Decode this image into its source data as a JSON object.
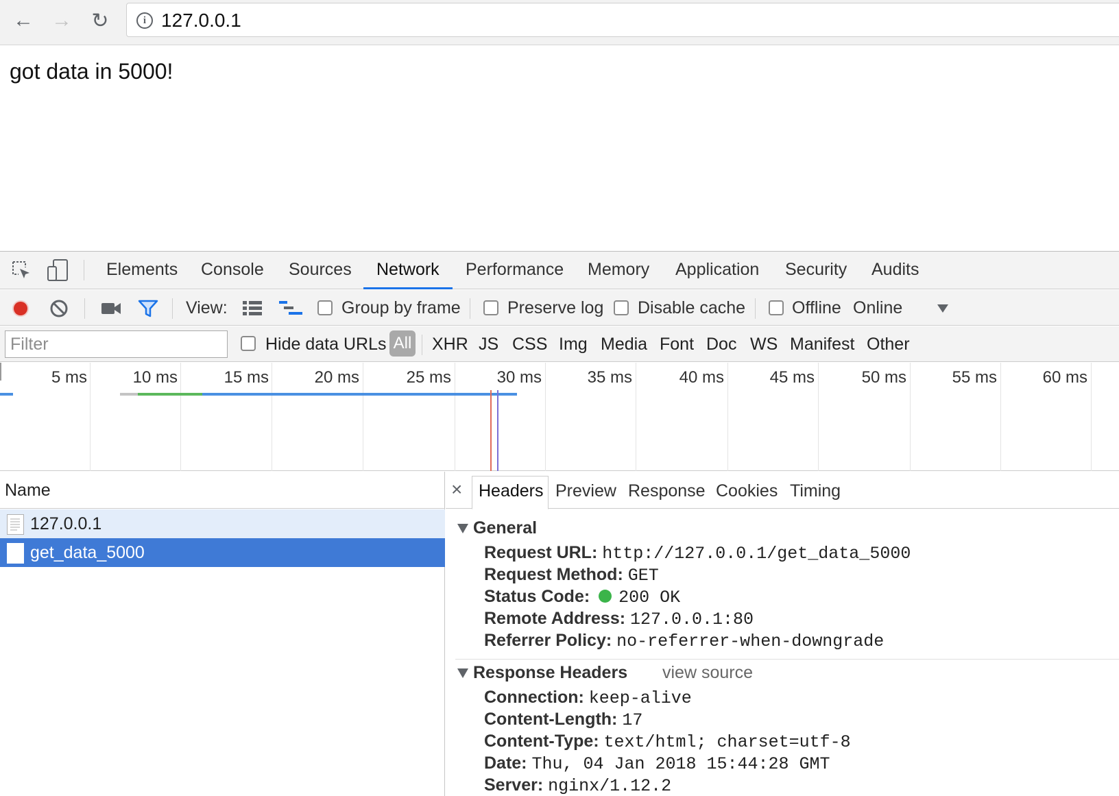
{
  "browser": {
    "back_icon": "←",
    "forward_icon": "→",
    "reload_icon": "↻",
    "info_icon": "i",
    "url": "127.0.0.1"
  },
  "page": {
    "text": "got data in 5000!"
  },
  "devtools": {
    "tabs": [
      "Elements",
      "Console",
      "Sources",
      "Network",
      "Performance",
      "Memory",
      "Application",
      "Security",
      "Audits"
    ],
    "active_tab": "Network",
    "toolbar": {
      "view_label": "View:",
      "group_by_frame": "Group by frame",
      "preserve_log": "Preserve log",
      "disable_cache": "Disable cache",
      "offline": "Offline",
      "online": "Online",
      "record_color": "#d93025",
      "filter_icon_color": "#1a73e8"
    },
    "filterbar": {
      "filter_placeholder": "Filter",
      "hide_data_urls": "Hide data URLs",
      "all": "All",
      "types": [
        "XHR",
        "JS",
        "CSS",
        "Img",
        "Media",
        "Font",
        "Doc",
        "WS",
        "Manifest",
        "Other"
      ]
    },
    "timeline": {
      "ticks": [
        "5 ms",
        "10 ms",
        "15 ms",
        "20 ms",
        "25 ms",
        "30 ms",
        "35 ms",
        "40 ms",
        "45 ms",
        "50 ms",
        "55 ms",
        "60 ms"
      ]
    },
    "requests": {
      "header": "Name",
      "rows": [
        {
          "name": "127.0.0.1",
          "selected": false
        },
        {
          "name": "get_data_5000",
          "selected": true
        }
      ]
    },
    "details": {
      "close_icon": "×",
      "tabs": [
        "Headers",
        "Preview",
        "Response",
        "Cookies",
        "Timing"
      ],
      "active_tab": "Headers",
      "general": {
        "title": "General",
        "items": [
          {
            "key": "Request URL:",
            "value": "http://127.0.0.1/get_data_5000"
          },
          {
            "key": "Request Method:",
            "value": "GET"
          },
          {
            "key": "Status Code:",
            "value": "200 OK"
          },
          {
            "key": "Remote Address:",
            "value": "127.0.0.1:80"
          },
          {
            "key": "Referrer Policy:",
            "value": "no-referrer-when-downgrade"
          }
        ]
      },
      "response_headers": {
        "title": "Response Headers",
        "view_source": "view source",
        "items": [
          {
            "key": "Connection:",
            "value": "keep-alive"
          },
          {
            "key": "Content-Length:",
            "value": "17"
          },
          {
            "key": "Content-Type:",
            "value": "text/html; charset=utf-8"
          },
          {
            "key": "Date:",
            "value": "Thu, 04 Jan 2018 15:44:28 GMT"
          },
          {
            "key": "Server:",
            "value": "nginx/1.12.2"
          }
        ]
      },
      "status_color": "#3bb44a"
    }
  }
}
